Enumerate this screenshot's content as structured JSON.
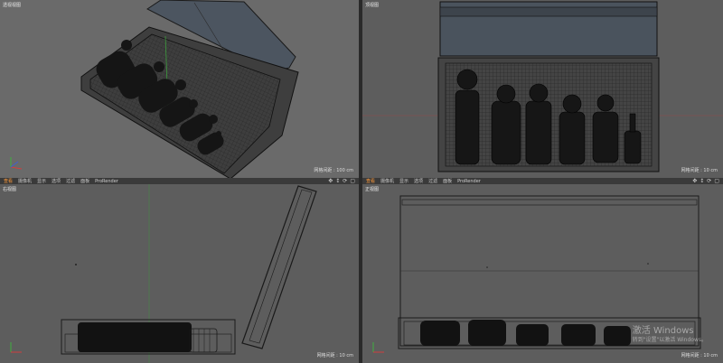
{
  "viewports": {
    "perspective": {
      "label": "透视视图",
      "scale": "网格间距 : 100 cm"
    },
    "top": {
      "label": "顶视图",
      "scale": "网格间距 : 10 cm"
    },
    "right": {
      "label": "右视图",
      "scale": "网格间距 : 10 cm"
    },
    "front": {
      "label": "正视图",
      "scale": "网格间距 : 10 cm"
    }
  },
  "menu_left": [
    "查看",
    "摄像机",
    "显示",
    "选项",
    "过滤",
    "面板",
    "ProRender"
  ],
  "menu_right": [
    "查看",
    "摄像机",
    "显示",
    "选项",
    "过滤",
    "面板",
    "ProRender"
  ],
  "nav_icons": [
    "move-icon",
    "zoom-icon",
    "rotate-icon",
    "maximize-icon"
  ],
  "watermark": {
    "title": "激活 Windows",
    "subtitle": "转到\"设置\"以激活 Windows。"
  },
  "colors": {
    "accent": "#ff9a3c",
    "viewport_bg": "#5d5d5d",
    "wire": "#111111"
  }
}
